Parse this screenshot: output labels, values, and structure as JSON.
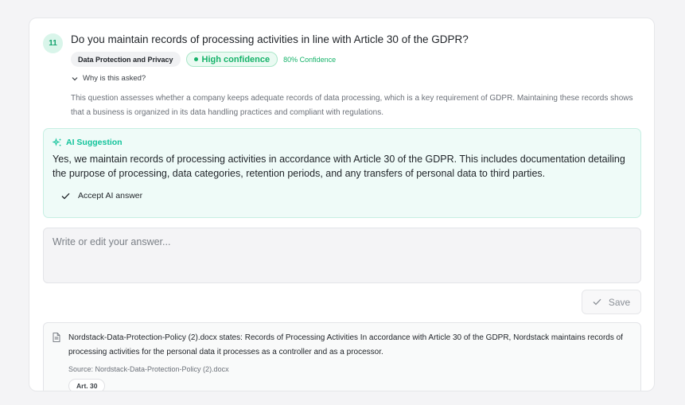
{
  "question": {
    "number": "11",
    "title": "Do you maintain records of processing activities in line with Article 30 of the GDPR?",
    "category": "Data Protection and Privacy",
    "confidence_label": "High confidence",
    "confidence_percent": "80% Confidence",
    "why_label": "Why is this asked?",
    "explanation": "This question assesses whether a company keeps adequate records of data processing, which is a key requirement of GDPR. Maintaining these records shows that a business is organized in its data handling practices and compliant with regulations."
  },
  "ai": {
    "heading": "AI Suggestion",
    "suggestion": "Yes, we maintain records of processing activities in accordance with Article 30 of the GDPR. This includes documentation detailing the purpose of processing, data categories, retention periods, and any transfers of personal data to third parties.",
    "accept_label": "Accept AI answer"
  },
  "answer": {
    "placeholder": "Write or edit your answer...",
    "value": ""
  },
  "save_label": "Save",
  "source": {
    "text": "Nordstack-Data-Protection-Policy (2).docx states: Records of Processing Activities In accordance with Article 30 of the GDPR, Nordstack maintains records of processing activities for the personal data it processes as a controller and as a processor.",
    "file": "Source: Nordstack-Data-Protection-Policy (2).docx",
    "tag": "Art. 30"
  },
  "icons": {
    "chevron": "chevron-down-icon",
    "sparkle": "sparkle-icon",
    "check": "check-icon",
    "document": "document-icon"
  },
  "colors": {
    "accent": "#16b36a",
    "ai_accent": "#12c39b",
    "ai_bg": "#effbf8"
  }
}
